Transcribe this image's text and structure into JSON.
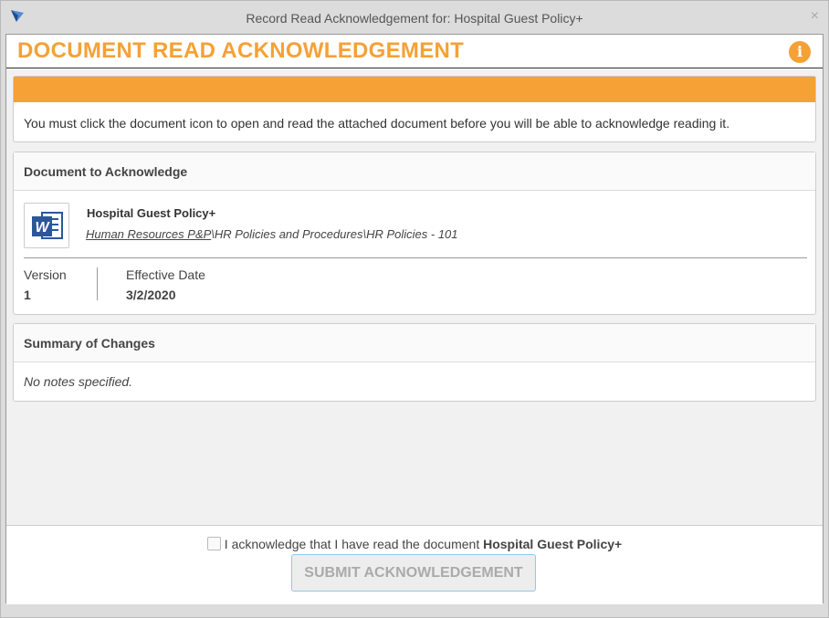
{
  "window": {
    "title": "Record Read Acknowledgement for: Hospital Guest Policy+",
    "close_label": "×"
  },
  "dialog": {
    "title": "DOCUMENT READ ACKNOWLEDGEMENT",
    "info_label": "i"
  },
  "alert": {
    "message": "You must click the document icon to open and read the attached document before you will be able to acknowledge reading it.",
    "accent_color": "#f5a135"
  },
  "document": {
    "section_title": "Document to Acknowledge",
    "icon": "word-document-icon",
    "icon_letter": "W",
    "name": "Hospital Guest Policy+",
    "path_link": "Human Resources P&P",
    "path_rest": "\\HR Policies and Procedures\\HR Policies - 101",
    "version_label": "Version",
    "version_value": "1",
    "effective_label": "Effective Date",
    "effective_value": "3/2/2020"
  },
  "summary": {
    "section_title": "Summary of Changes",
    "notes": "No notes specified."
  },
  "footer": {
    "ack_prefix": "I acknowledge that I have read the document",
    "ack_doc_name": "Hospital Guest Policy+",
    "submit_label": "SUBMIT ACKNOWLEDGEMENT"
  }
}
